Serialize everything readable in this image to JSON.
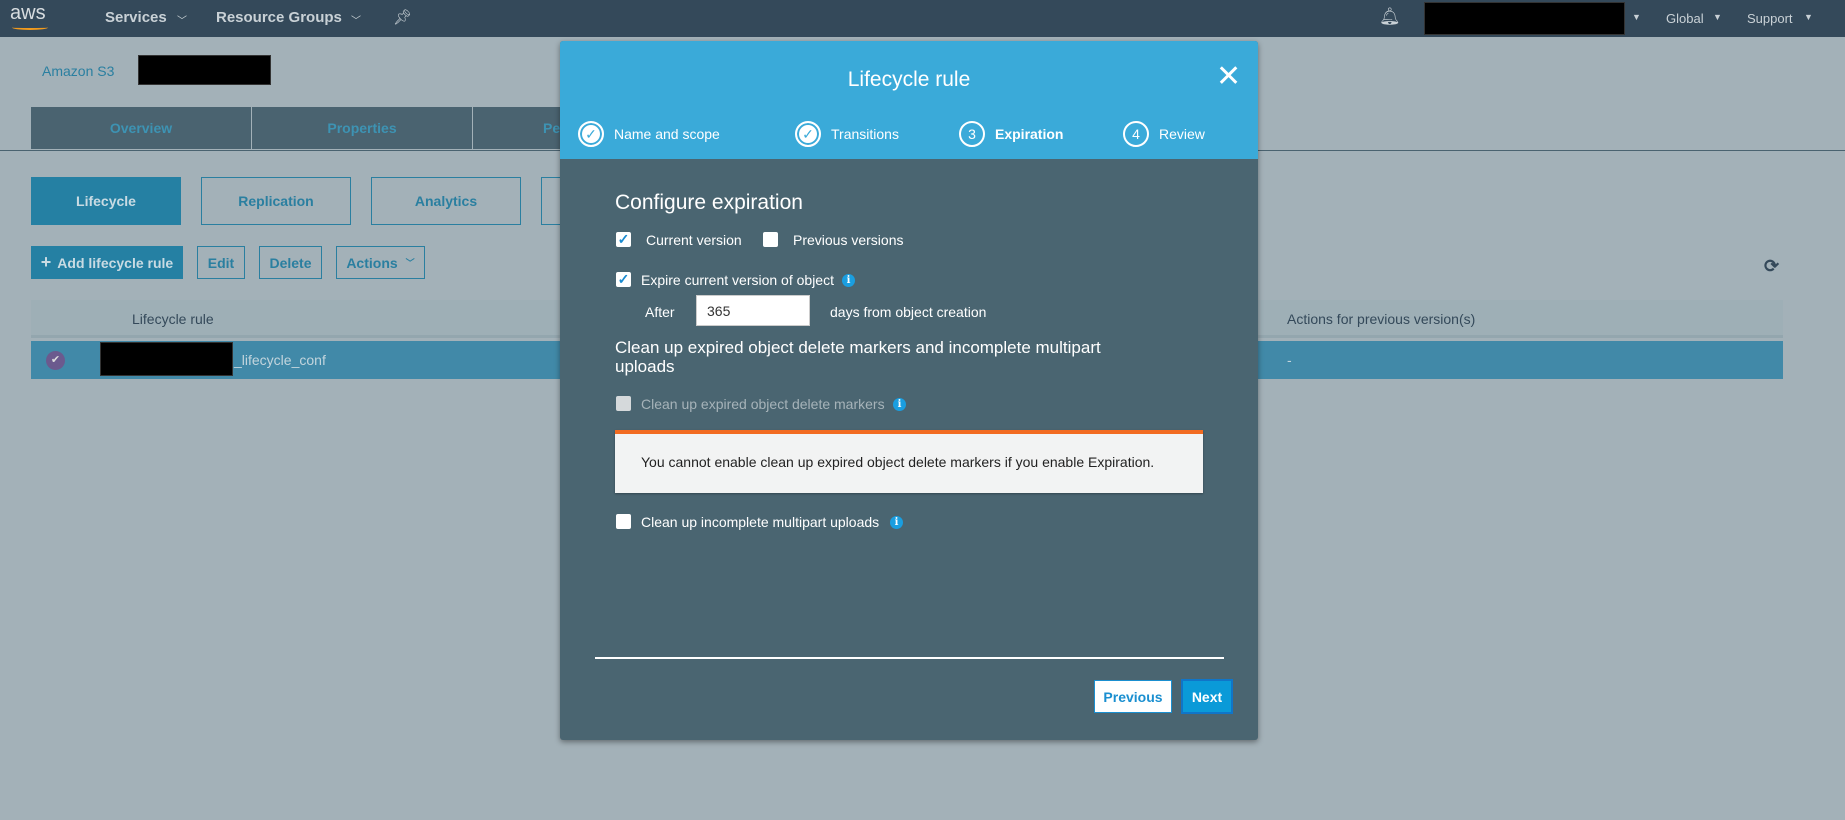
{
  "nav": {
    "logo": "aws",
    "services": "Services",
    "resource_groups": "Resource Groups",
    "region": "Global",
    "support": "Support"
  },
  "breadcrumb": {
    "service": "Amazon S3"
  },
  "tabs": [
    "Overview",
    "Properties",
    "Pe"
  ],
  "subtabs": [
    "Lifecycle",
    "Replication",
    "Analytics"
  ],
  "toolbar": {
    "add": "Add lifecycle rule",
    "edit": "Edit",
    "delete": "Delete",
    "actions": "Actions"
  },
  "table": {
    "col1": "Lifecycle rule",
    "col_last": "Actions for previous version(s)",
    "row": {
      "name_suffix": "_lifecycle_conf",
      "prev_actions": "-"
    }
  },
  "modal": {
    "title": "Lifecycle rule",
    "steps": [
      {
        "label": "Name and scope",
        "state": "done"
      },
      {
        "label": "Transitions",
        "state": "done"
      },
      {
        "label": "Expiration",
        "num": "3",
        "state": "active"
      },
      {
        "label": "Review",
        "num": "4",
        "state": "pending"
      }
    ],
    "heading": "Configure expiration",
    "current_version": {
      "label": "Current version",
      "checked": true
    },
    "previous_versions": {
      "label": "Previous versions",
      "checked": false
    },
    "expire_current": {
      "label": "Expire current version of object",
      "checked": true
    },
    "after_label": "After",
    "after_value": "365",
    "after_suffix": "days from object creation",
    "cleanup_heading": "Clean up expired object delete markers and incomplete multipart uploads",
    "cleanup_markers": {
      "label": "Clean up expired object delete markers",
      "checked": false,
      "disabled": true
    },
    "alert": "You cannot enable clean up expired object delete markers if you enable Expiration.",
    "cleanup_multipart": {
      "label": "Clean up incomplete multipart uploads",
      "checked": false
    },
    "previous_btn": "Previous",
    "next_btn": "Next"
  },
  "colors": {
    "header": "#3aaad9",
    "body": "#4a6571",
    "alert_accent": "#f26b21",
    "nav": "#34495a"
  }
}
